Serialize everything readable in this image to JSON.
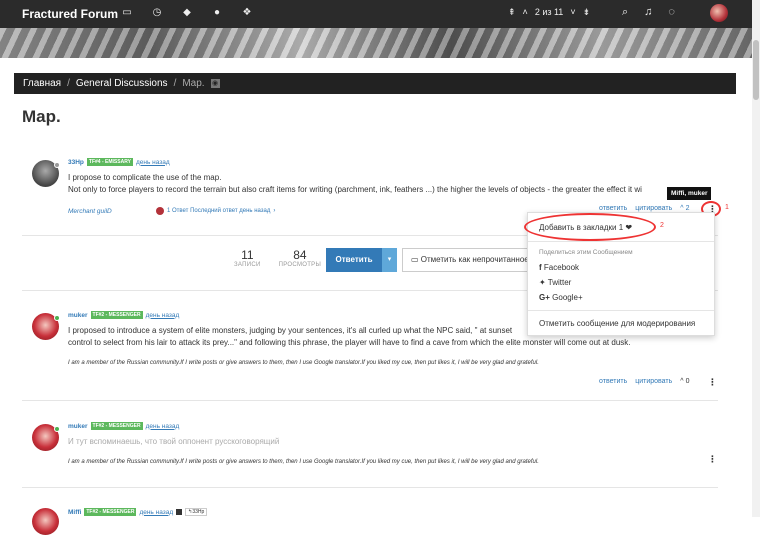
{
  "app": {
    "brand": "Fractured Forum",
    "pager": "2 из 11",
    "colors": {
      "accent": "#337ab7",
      "topbar": "#2b2b2b",
      "badge": "#5cb85c",
      "highlight": "#e33333"
    }
  },
  "breadcrumb": {
    "home": "Главная",
    "category": "General Discussions",
    "current": "Map."
  },
  "topic": {
    "title": "Map.",
    "stats": {
      "posts_value": "11",
      "posts_label": "ЗАПИСИ",
      "views_value": "84",
      "views_label": "ПРОСМОТРЫ"
    },
    "reply_label": "Ответить",
    "mark_unread_label": "Отметить как непрочитанное"
  },
  "posts": [
    {
      "author": "33Hp",
      "badge": "TF#4 - EMISSARY",
      "time": "день назад",
      "line1": "I propose to complicate the use of the map.",
      "line2": "Not only to force players to record the terrain but also craft items for writing (parchment, ink, feathers ...) the higher the levels of objects - the greater the effect it wi",
      "signature": "Merchant guilD",
      "replies": "1 Ответ Последний ответ день назад",
      "reply": "ответить",
      "quote": "цитировать",
      "votes": "2"
    },
    {
      "author": "muker",
      "badge": "TF#2 - MESSENGER",
      "time": "день назад",
      "line1": "I proposed to introduce a system of elite monsters, judging by your sentences, it's all curled up what the NPC said, \" at sunset",
      "line2": "control to select from his lair to attack its prey...\" and following this phrase, the player will have to find a cave from which the elite monster will come out at dusk.",
      "signature": "I am a member of the Russian community.If I write posts or give answers to them, then I use Google translator.If you liked my cue, then put likes it, I will be very glad and grateful.",
      "reply": "ответить",
      "quote": "цитировать",
      "votes": "0"
    },
    {
      "author": "muker",
      "badge": "TF#2 - MESSENGER",
      "time": "день назад",
      "line1": "И тут вспоминаешь, что твой оппонент русскоговорящий",
      "signature": "I am a member of the Russian community.If I write posts or give answers to them, then I use Google translator.If you liked my cue, then put likes it, I will be very glad and grateful."
    },
    {
      "author": "Miffi",
      "badge": "TF#2 - MESSENGER",
      "time": "день назад",
      "reply_to": "33Hp"
    }
  ],
  "dropdown": {
    "bookmark": "Добавить в закладки 1",
    "share_header": "Поделиться этим Сообщением",
    "facebook": "Facebook",
    "twitter": "Twitter",
    "google": "Google+",
    "flag": "Отметить сообщение для модерирования"
  },
  "tooltip": "Miffi, muker",
  "annotations": {
    "n1": "1",
    "n2": "2"
  }
}
